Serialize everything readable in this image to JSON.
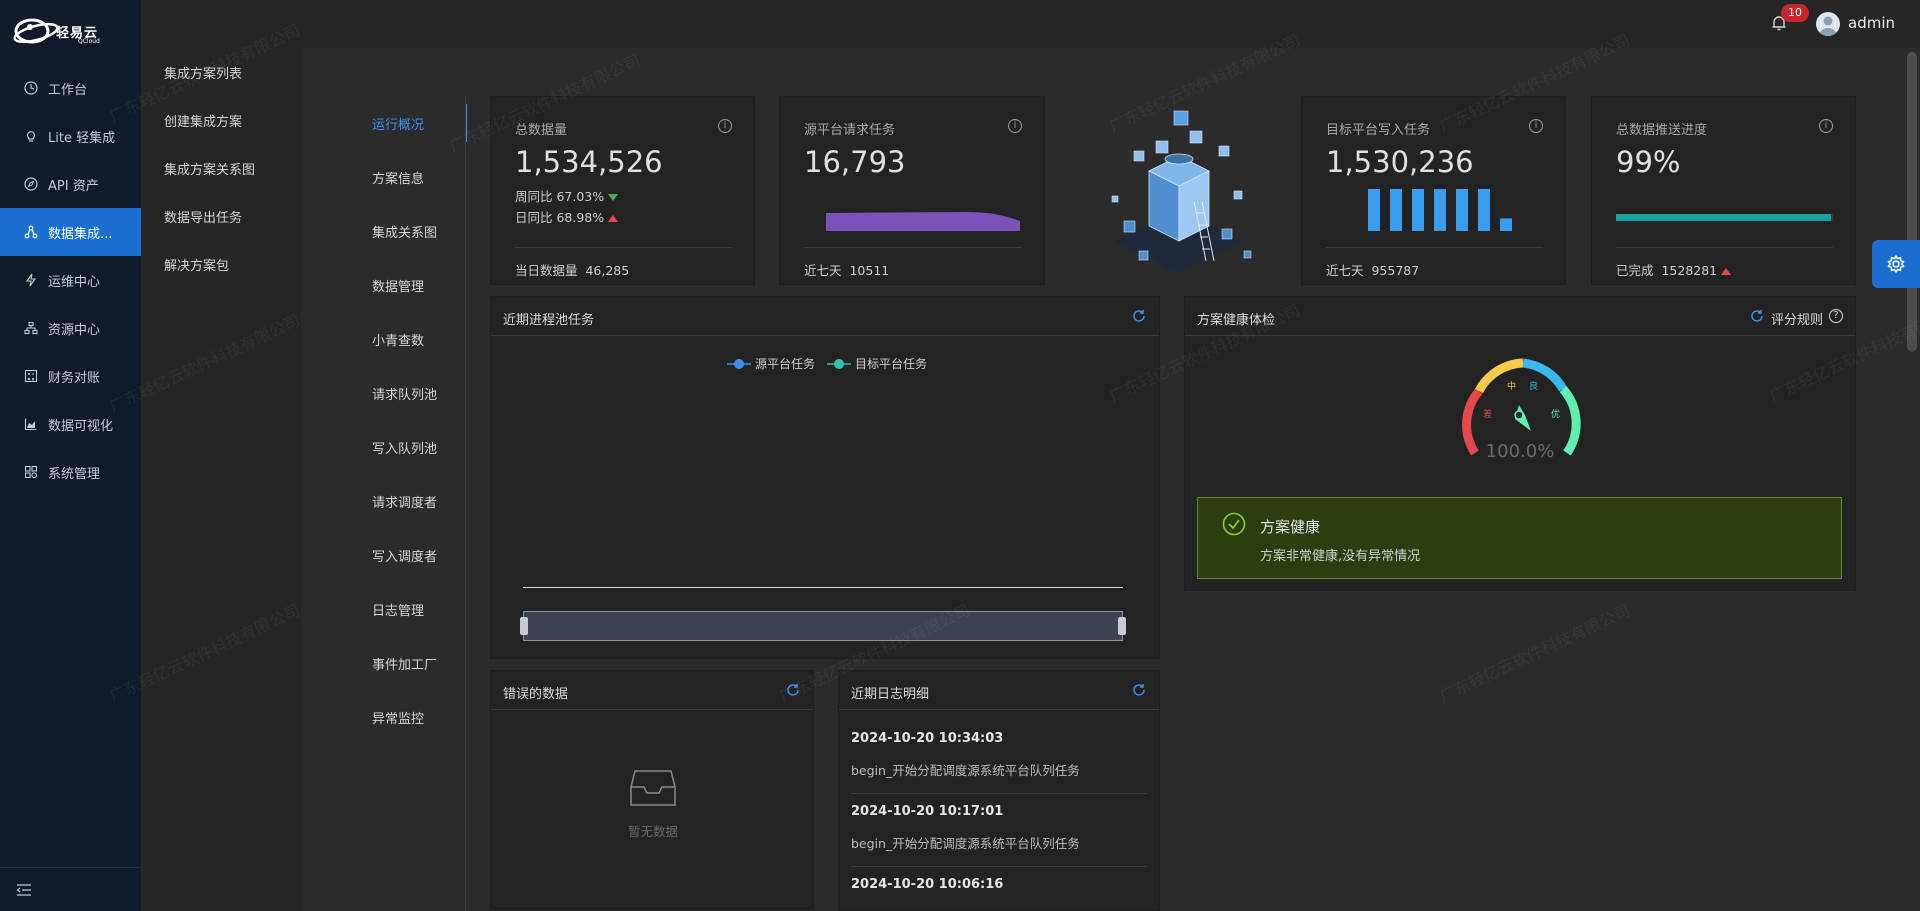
{
  "brand": {
    "name": "轻易云",
    "sub": "QCloud"
  },
  "nav": [
    {
      "label": "工作台",
      "icon": "dashboard-icon"
    },
    {
      "label": "Lite 轻集成",
      "icon": "bulb-icon"
    },
    {
      "label": "API 资产",
      "icon": "compass-icon"
    },
    {
      "label": "数据集成...",
      "icon": "integration-icon",
      "active": true
    },
    {
      "label": "运维中心",
      "icon": "bolt-icon"
    },
    {
      "label": "资源中心",
      "icon": "cluster-icon"
    },
    {
      "label": "财务对账",
      "icon": "calculator-icon"
    },
    {
      "label": "数据可视化",
      "icon": "area-chart-icon"
    },
    {
      "label": "系统管理",
      "icon": "settings-icon"
    }
  ],
  "submenu": [
    "集成方案列表",
    "创建集成方案",
    "集成方案关系图",
    "数据导出任务",
    "解决方案包"
  ],
  "user": {
    "name": "admin",
    "notifications": "10"
  },
  "tabs": [
    "运行概况",
    "方案信息",
    "集成关系图",
    "数据管理",
    "小青查数",
    "请求队列池",
    "写入队列池",
    "请求调度者",
    "写入调度者",
    "日志管理",
    "事件加工厂",
    "异常监控"
  ],
  "stats": {
    "total": {
      "title": "总数据量",
      "value": "1,534,526",
      "wow": "周同比 67.03%",
      "dod": "日同比 68.98%",
      "foot_label": "当日数据量",
      "foot_value": "46,285"
    },
    "source": {
      "title": "源平台请求任务",
      "value": "16,793",
      "foot_label": "近七天",
      "foot_value": "10511"
    },
    "target": {
      "title": "目标平台写入任务",
      "value": "1,530,236",
      "foot_label": "近七天",
      "foot_value": "955787",
      "bars": [
        1,
        1,
        1,
        1,
        1,
        1,
        0.3
      ]
    },
    "progress": {
      "title": "总数据推送进度",
      "value": "99%",
      "percent": 99,
      "foot_label": "已完成",
      "foot_value": "1528281"
    }
  },
  "pool_panel": {
    "title": "近期进程池任务",
    "legend": [
      "源平台任务",
      "目标平台任务"
    ]
  },
  "health_panel": {
    "title": "方案健康体检",
    "rule_label": "评分规则",
    "gauge_value": "100.0%",
    "gauge_percent": 100,
    "gauge_labels": [
      "差",
      "中",
      "良",
      "优"
    ],
    "status_title": "方案健康",
    "status_desc": "方案非常健康,没有异常情况"
  },
  "error_panel": {
    "title": "错误的数据",
    "empty_text": "暂无数据"
  },
  "log_panel": {
    "title": "近期日志明细",
    "items": [
      {
        "time": "2024-10-20 10:34:03",
        "msg": "begin_开始分配调度源系统平台队列任务"
      },
      {
        "time": "2024-10-20 10:17:01",
        "msg": "begin_开始分配调度源系统平台队列任务"
      },
      {
        "time": "2024-10-20 10:06:16",
        "msg": ""
      }
    ]
  },
  "watermark": "广东轻亿云软件科技有限公司",
  "colors": {
    "accent": "#1a6fd0",
    "link": "#3e8ff0",
    "bar": "#3a9df0",
    "area": "#7a52b8",
    "progress": "#1aa39a",
    "health_bg": "#2c3d10"
  }
}
